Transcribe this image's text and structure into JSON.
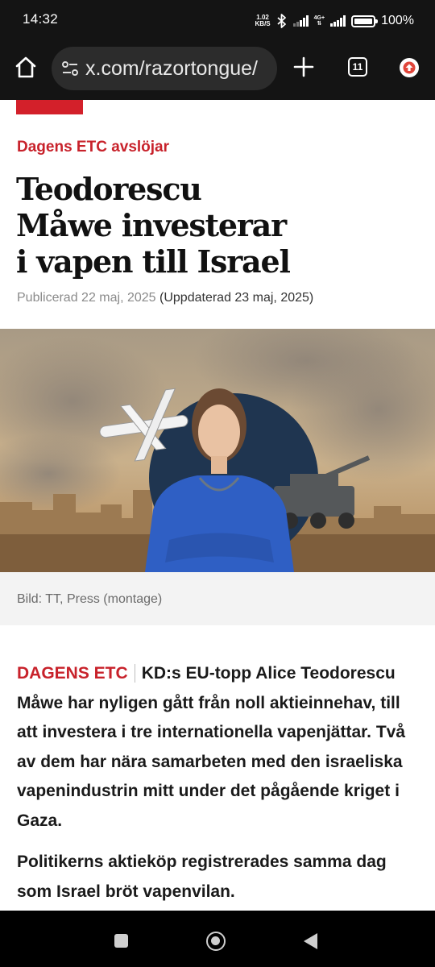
{
  "status_bar": {
    "time": "14:32",
    "net_speed_value": "1.02",
    "net_speed_unit": "KB/S",
    "network_type": "4G+",
    "battery_percent": "100%",
    "icons": [
      "bluetooth-icon",
      "signal-icon",
      "battery-icon"
    ]
  },
  "browser": {
    "url": "x.com/razortongue/",
    "tab_count": "11",
    "icons": [
      "home-icon",
      "site-settings-icon",
      "new-tab-icon",
      "tab-switcher-icon",
      "upgrade-icon"
    ]
  },
  "article": {
    "kicker": "Dagens ETC avslöjar",
    "headline_lines": [
      "Teodorescu",
      "Måwe investerar",
      "i vapen till Israel"
    ],
    "published": "Publicerad 22 maj, 2025",
    "updated": "(Uppdaterad 23 maj, 2025)",
    "image_caption": "Bild: TT, Press (montage)",
    "lead_tag": "DAGENS ETC",
    "lead_text": "KD:s EU-topp Alice Teodorescu Måwe har nyligen gått från noll aktieinnehav, till att investera i tre internationella vapenjättar. Två av dem har nära samarbeten med den israeliska vapenindustrin mitt under det pågående kriget i Gaza.",
    "paragraph_2": "Politikerns aktieköp registrerades samma dag som Israel bröt vapenvilan."
  },
  "colors": {
    "accent_red": "#c8222b",
    "system_bar": "#141414"
  }
}
